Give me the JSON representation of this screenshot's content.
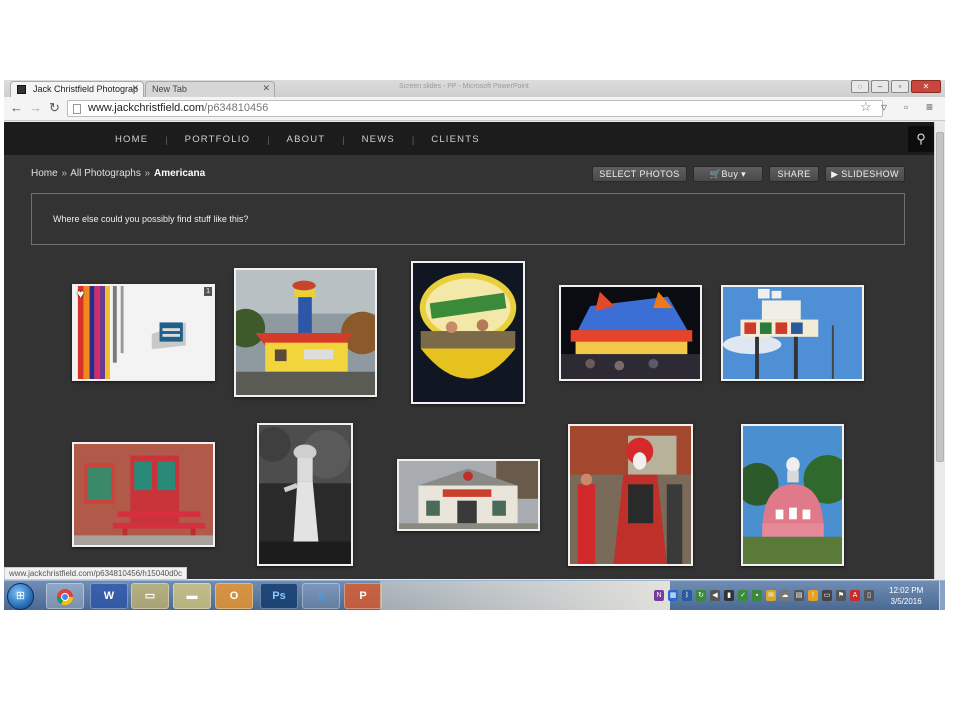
{
  "browser": {
    "tabs": [
      {
        "title": "Jack Christfield Photograp",
        "active": true
      },
      {
        "title": "New Tab",
        "active": false
      }
    ],
    "background_window_title": "Screen slides - PP - Microsoft PowerPoint",
    "url_domain": "www.jackchristfield.com",
    "url_path": "/p634810456",
    "status_url": "www.jackchristfield.com/p634810456/h15040d0c"
  },
  "site": {
    "nav": [
      "HOME",
      "PORTFOLIO",
      "ABOUT",
      "NEWS",
      "CLIENTS"
    ],
    "breadcrumb": {
      "home": "Home",
      "gallery": "All Photographs",
      "current": "Americana",
      "separator": "»"
    },
    "buttons": {
      "select": "SELECT PHOTOS",
      "buy": "Buy ▾",
      "share": "SHARE",
      "slideshow": "▶ SLIDESHOW"
    },
    "description": "Where else could you possibly find stuff like this?",
    "photos": [
      {
        "subject": "Johnnie Jack sign on white wall with colored stripes",
        "favorited": true,
        "badge": "1"
      },
      {
        "subject": "Yellow house with lighthouse and airplane"
      },
      {
        "subject": "Lemonade stand at night"
      },
      {
        "subject": "Himalaya carnival ride at night"
      },
      {
        "subject": "Sky Lanes bowling sign"
      },
      {
        "subject": "Red bench and red door on brick building"
      },
      {
        "subject": "Black and white statue in woods"
      },
      {
        "subject": "Old country store"
      },
      {
        "subject": "Queen of Hearts costume parade"
      },
      {
        "subject": "Pink dome building with statue"
      }
    ]
  },
  "taskbar": {
    "apps": [
      "chrome-icon",
      "word-icon",
      "explorer-icon",
      "folder-icon",
      "outlook-icon",
      "photoshop-icon",
      "ie-icon",
      "powerpoint-icon"
    ],
    "time": "12:02 PM",
    "date": "3/5/2016"
  }
}
